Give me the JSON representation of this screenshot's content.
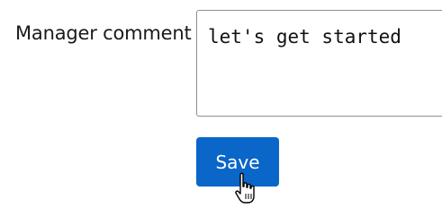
{
  "form": {
    "comment_label": "Manager comment",
    "comment_value": "let's get started",
    "save_label": "Save"
  },
  "colors": {
    "button_bg": "#0a66c8",
    "button_text": "#ffffff",
    "field_border": "#8f8f8f"
  },
  "icons": {
    "cursor": "hand-pointer-icon"
  }
}
